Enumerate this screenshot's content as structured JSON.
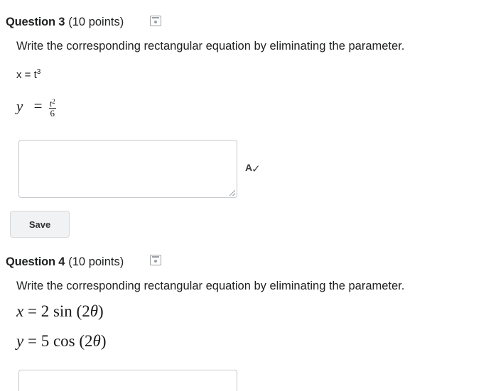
{
  "q3": {
    "title": "Question 3",
    "points": "(10 points)",
    "prompt": "Write the corresponding rectangular equation by eliminating the parameter.",
    "eq_x": {
      "lhs": "x = t",
      "exp": "3"
    },
    "eq_y": {
      "lhs": "y",
      "op": "=",
      "num": "t",
      "num_exp": "2",
      "den": "6"
    },
    "answer_value": "",
    "save_label": "Save"
  },
  "q4": {
    "title": "Question 4",
    "points": "(10 points)",
    "prompt": "Write the corresponding rectangular equation by eliminating the parameter.",
    "eq_x": {
      "var": "x",
      "rhs": " = 2 sin (2",
      "theta": "θ",
      "close": ")"
    },
    "eq_y": {
      "var": "y",
      "rhs": " = 5 cos (2",
      "theta": "θ",
      "close": ")"
    }
  },
  "icons": {
    "save": "save-disk-icon",
    "spellcheck": "spellcheck-icon"
  },
  "spellcheck_glyph": "A",
  "spellcheck_check": "✓"
}
